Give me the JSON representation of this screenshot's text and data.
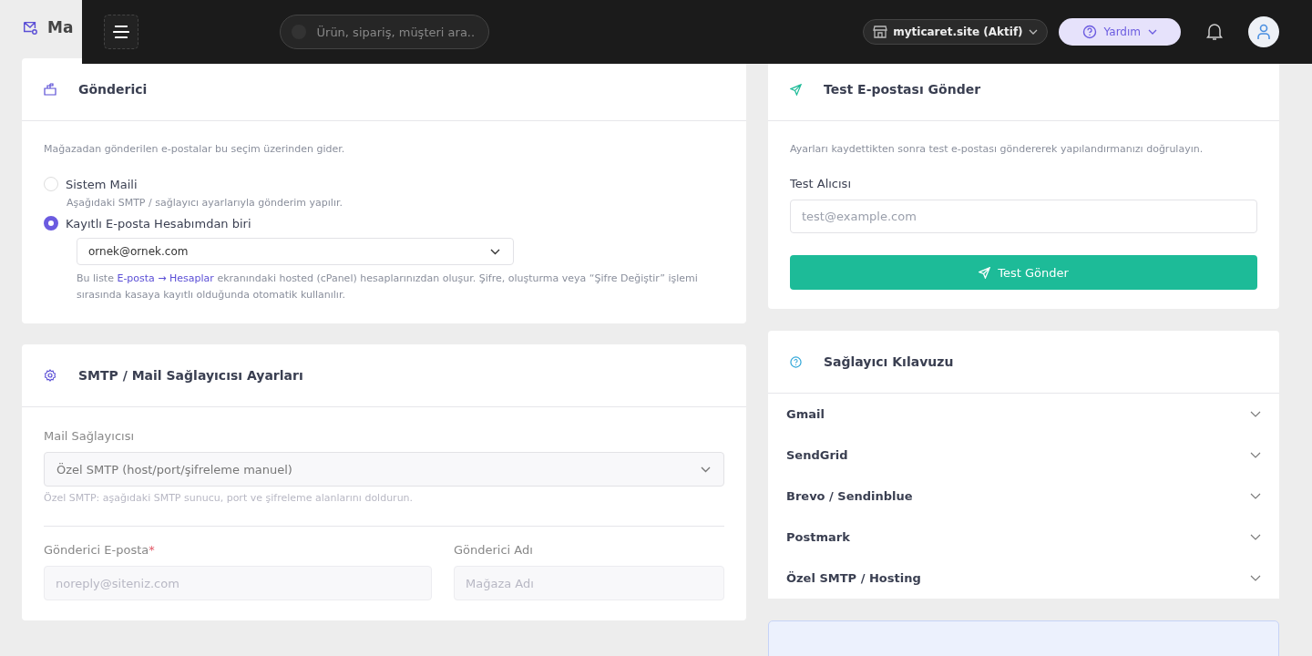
{
  "page_title": "Ma",
  "topbar": {
    "search": {
      "placeholder": "Ürün, sipariş, müşteri ara.."
    },
    "store": "myticaret.site (Aktif)",
    "help": "Yardım"
  },
  "sender_card": {
    "title": "Gönderici",
    "description": "Mağazadan gönderilen e-postalar bu seçim üzerinden gider.",
    "options": [
      {
        "label": "Sistem Maili",
        "hint": "Aşağıdaki SMTP / sağlayıcı ayarlarıyla gönderim yapılır.",
        "selected": false
      },
      {
        "label": "Kayıtlı E-posta Hesabımdan biri",
        "selected": true
      }
    ],
    "account_select": "ornek@ornek.com",
    "note_before": "Bu liste",
    "note_link": "E-posta → Hesaplar",
    "note_after": "ekranındaki hosted (cPanel) hesaplarınızdan oluşur. Şifre, oluşturma veya “Şifre Değiştir” işlemi sırasında kasaya kayıtlı olduğunda otomatik kullanılır."
  },
  "smtp_card": {
    "title": "SMTP / Mail Sağlayıcısı Ayarları",
    "provider_label": "Mail Sağlayıcısı",
    "provider_value": "Özel SMTP (host/port/şifreleme manuel)",
    "provider_hint": "Özel SMTP: aşağıdaki SMTP sunucu, port ve şifreleme alanlarını doldurun.",
    "fields": [
      {
        "label": "Gönderici E-posta",
        "required_mark": "*",
        "placeholder": "noreply@siteniz.com"
      },
      {
        "label": "Gönderici Adı",
        "placeholder": "Mağaza Adı"
      }
    ]
  },
  "test_card": {
    "title": "Test E-postası Gönder",
    "description": "Ayarları kaydettikten sonra test e-postası göndererek yapılandırmanızı doğrulayın.",
    "label": "Test Alıcısı",
    "placeholder": "test@example.com",
    "button": "Test Gönder"
  },
  "guide_card": {
    "title": "Sağlayıcı Kılavuzu",
    "items": [
      {
        "label": "Gmail",
        "expanded": false
      },
      {
        "label": "SendGrid",
        "expanded": false
      },
      {
        "label": "Brevo / Sendinblue",
        "expanded": false
      },
      {
        "label": "Postmark",
        "expanded": false
      },
      {
        "label": "Özel SMTP / Hosting",
        "expanded": false
      }
    ]
  }
}
